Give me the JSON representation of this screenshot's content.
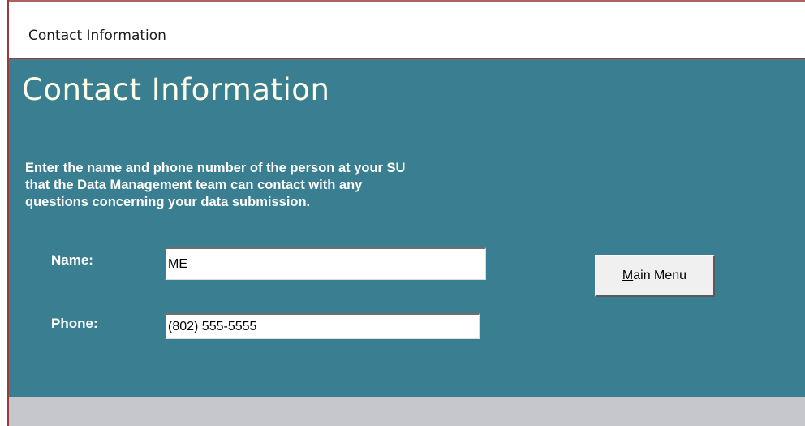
{
  "window": {
    "title": "Contact Information"
  },
  "form": {
    "heading": "Contact Information",
    "instructions": [
      "Enter the name and phone number of the person at your SU",
      "that the Data Management team can contact with any",
      "questions concerning your data submission."
    ],
    "name_label": "Name:",
    "name_value": "ME",
    "phone_label": "Phone:",
    "phone_value": "(802) 555-5555",
    "main_menu_button": {
      "accelerator": "M",
      "rest": "ain Menu"
    }
  },
  "colors": {
    "form_background": "#3a7f91",
    "footer_background": "#c6c7cc",
    "heading_text": "#fffde8",
    "window_border": "#9b3b3b"
  }
}
